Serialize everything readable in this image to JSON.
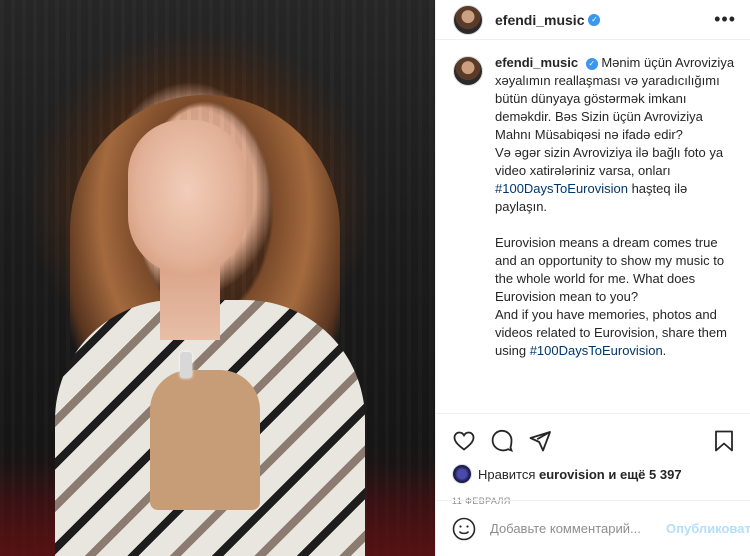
{
  "post": {
    "username": "efendi_music",
    "verified": true,
    "caption_parts": {
      "az_1": "Mənim üçün Avroviziya xəyalımın reallaşması və yaradıcılığımı bütün dünyaya göstərmək imkanı deməkdir. Bəs Sizin üçün Avroviziya Mahnı Müsabiqəsi nə ifadə edir?\nVə əgər sizin Avroviziya ilə bağlı foto ya video xatirələriniz varsa, onları ",
      "hashtag_1": "#100DaysToEurovision",
      "az_2": " haşteq ilə paylaşın.\n\nEurovision means a dream comes true and an opportunity to show my music to the whole world for me. What does Eurovision mean to you?\nAnd if you have memories, photos and videos related to Eurovision, share them using ",
      "hashtag_2": "#100DaysToEurovision",
      "end": "."
    }
  },
  "actions": {
    "icons": [
      "heart-icon",
      "comment-icon",
      "share-icon",
      "bookmark-icon"
    ]
  },
  "likes": {
    "prefix": "Нравится",
    "user": "eurovision",
    "suffix": "и ещё 5 397"
  },
  "date": "11 февраля",
  "comment": {
    "placeholder": "Добавьте комментарий...",
    "publish_label": "Опубликовать"
  },
  "colors": {
    "verified": "#3897f0",
    "hashtag": "#00376b",
    "publish_disabled": "#b2dffc"
  }
}
